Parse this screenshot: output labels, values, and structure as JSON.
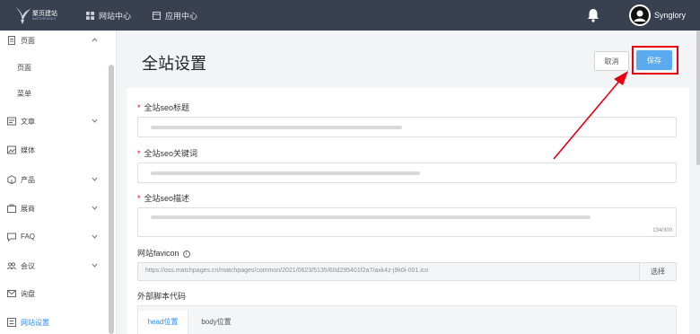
{
  "header": {
    "logo_name": "聚页建站",
    "logo_sub": "MATCHPAGES",
    "nav": [
      {
        "label": "网站中心",
        "icon": "grid-icon"
      },
      {
        "label": "应用中心",
        "icon": "app-window-icon"
      }
    ],
    "bell_icon": "bell-icon",
    "username": "Synglory"
  },
  "sidebar": {
    "items": [
      {
        "label": "页面",
        "icon": "page-icon",
        "expanded": true
      },
      {
        "label": "页面",
        "sub": true
      },
      {
        "label": "菜单",
        "sub": true
      },
      {
        "label": "文章",
        "icon": "article-icon"
      },
      {
        "label": "媒体",
        "icon": "media-icon"
      },
      {
        "label": "产品",
        "icon": "product-icon"
      },
      {
        "label": "展商",
        "icon": "exhibitor-icon"
      },
      {
        "label": "FAQ",
        "icon": "faq-icon"
      },
      {
        "label": "会议",
        "icon": "meeting-icon"
      },
      {
        "label": "询盘",
        "icon": "inquiry-icon"
      },
      {
        "label": "网站设置",
        "icon": "settings-icon",
        "active": true
      }
    ]
  },
  "main": {
    "title": "全站设置",
    "cancel_label": "取消",
    "save_label": "保存",
    "fields": {
      "seo_title_label": "全站seo标题",
      "seo_keywords_label": "全站seo关键词",
      "seo_desc_label": "全站seo描述",
      "seo_desc_counter": "134/300",
      "favicon_label": "网站favicon",
      "favicon_value": "https://oss.matchpages.cn/matchpages/common/2021/0623/5135/60d295401f2a7/axk4z-j9k0i-001.ico",
      "favicon_button": "选择",
      "script_label": "外部脚本代码"
    },
    "tabs": [
      "head位置",
      "body位置"
    ]
  },
  "colors": {
    "topbar": "#394050",
    "primary": "#5aabef",
    "active_text": "#2d8cf0",
    "highlight": "#e60012"
  }
}
